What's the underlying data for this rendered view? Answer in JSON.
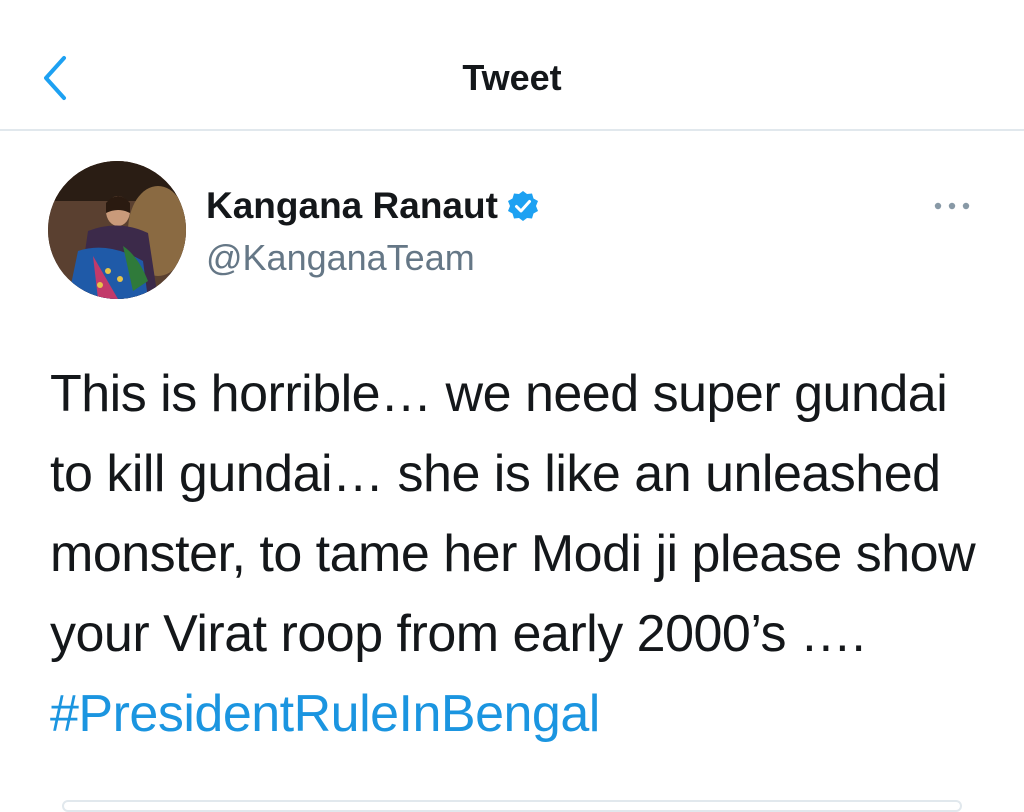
{
  "header": {
    "title": "Tweet",
    "back_icon": "chevron-left-icon",
    "accent_color": "#1da1f2"
  },
  "tweet": {
    "author": {
      "display_name": "Kangana Ranaut",
      "handle": "@KanganaTeam",
      "verified": true,
      "verified_icon": "verified-badge-icon"
    },
    "more_icon": "more-horizontal-icon",
    "text": "This is horrible… we need super gundai to kill gundai… she is like an unleashed monster, to tame her Modi ji please show your Virat roop from early 2000’s …. ",
    "hashtag": "#PresidentRuleInBengal",
    "hashtag_color": "#1b95e0"
  }
}
